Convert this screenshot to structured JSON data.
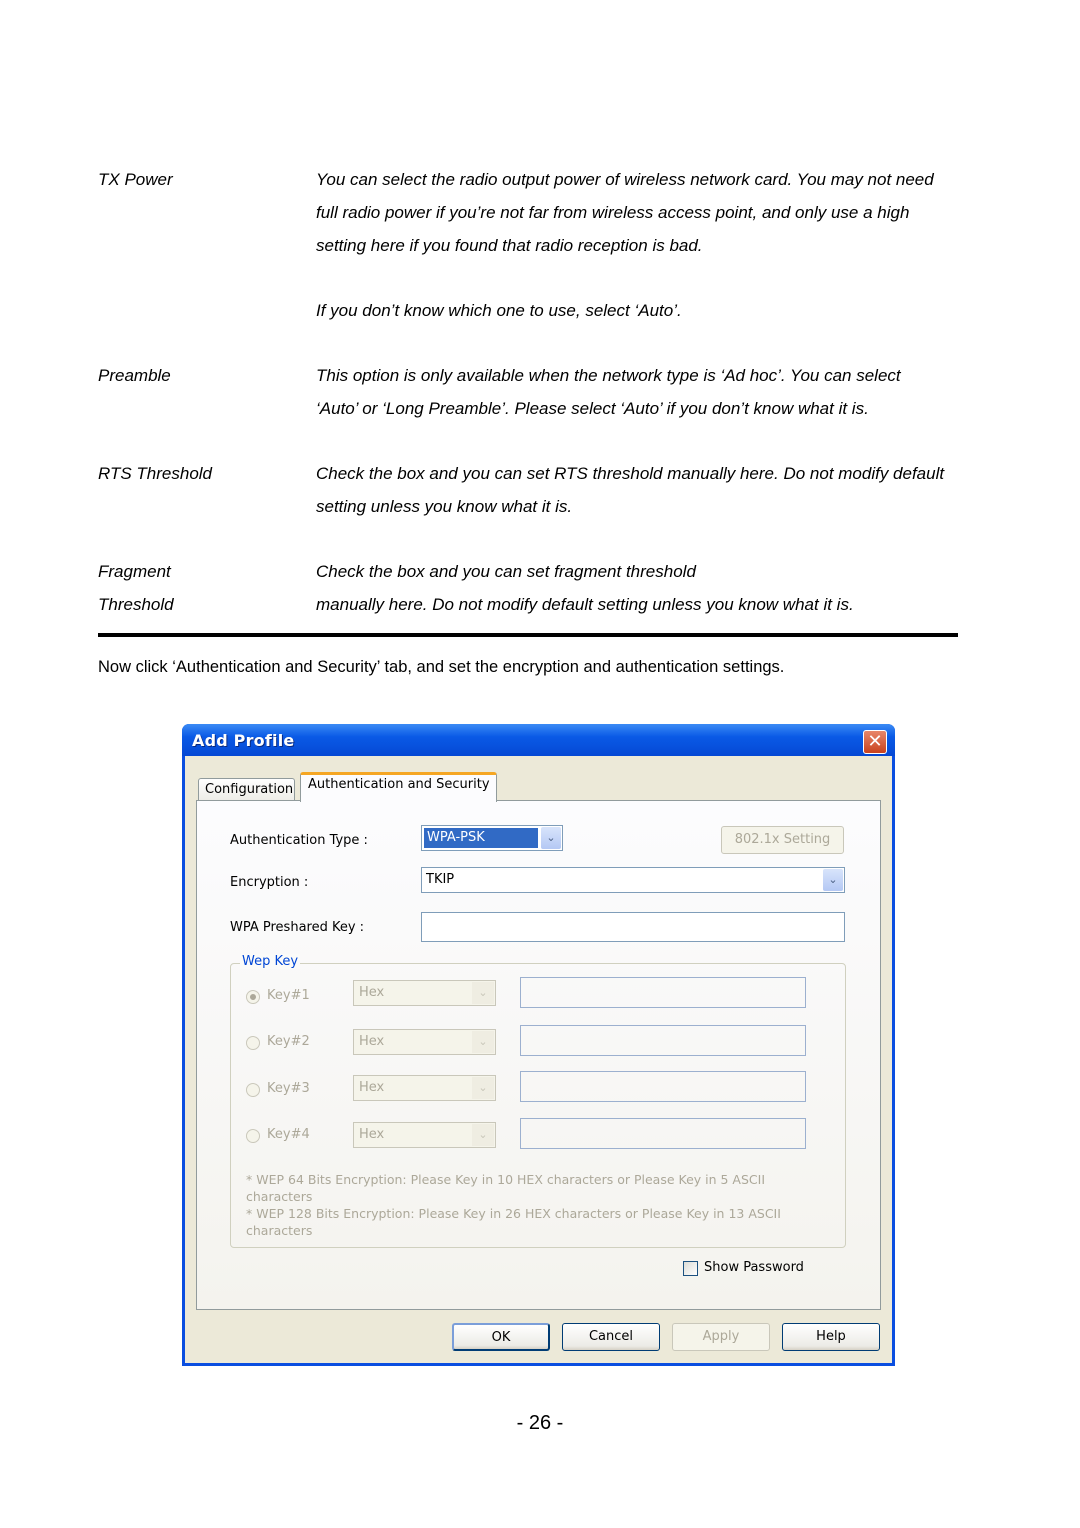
{
  "definitions": [
    {
      "term": "TX Power",
      "desc": [
        "You can select the radio output power of wireless network card. You may not need",
        "full radio power if you’re not far from wireless access point, and only use a high",
        "setting here if you found that radio reception is bad.",
        "",
        "If you don’t know which one to use, select ‘Auto’."
      ]
    },
    {
      "term": "Preamble",
      "desc": [
        "This option is only available when the network type is ‘Ad hoc’. You can select",
        "‘Auto’ or ‘Long Preamble’. Please select ‘Auto’ if you don’t know what it is."
      ]
    },
    {
      "term": "RTS Threshold",
      "desc": [
        "Check the box and you can set RTS threshold manually here. Do not modify default",
        "setting unless you know what it is."
      ]
    },
    {
      "term_lines": [
        "Fragment",
        "Threshold"
      ],
      "desc": [
        "Check the box and you can set fragment threshold",
        "manually here. Do not modify default setting unless you know what it is."
      ]
    }
  ],
  "intro": "Now click ‘Authentication and Security’ tab, and set the encryption and authentication settings.",
  "dialog": {
    "title": "Add Profile",
    "close_glyph": "✕",
    "tabs": [
      {
        "label": "Configuration",
        "active": false
      },
      {
        "label": "Authentication and Security",
        "active": true
      }
    ],
    "auth_type": {
      "label": "Authentication Type :",
      "value": "WPA-PSK"
    },
    "setting_button": "802.1x Setting",
    "encryption": {
      "label": "Encryption :",
      "value": "TKIP"
    },
    "preshared_key": {
      "label": "WPA Preshared Key :",
      "value": ""
    },
    "wep_group": {
      "legend": "Wep Key",
      "keys": [
        {
          "label": "Key#1",
          "format": "Hex",
          "checked": true,
          "value": ""
        },
        {
          "label": "Key#2",
          "format": "Hex",
          "checked": false,
          "value": ""
        },
        {
          "label": "Key#3",
          "format": "Hex",
          "checked": false,
          "value": ""
        },
        {
          "label": "Key#4",
          "format": "Hex",
          "checked": false,
          "value": ""
        }
      ],
      "notes": [
        "* WEP 64 Bits Encryption:   Please Key in 10 HEX characters  or   Please Key in 5 ASCII",
        "characters",
        "* WEP 128 Bits Encryption:   Please Key in 26 HEX characters  or  Please Key in 13 ASCII",
        "characters"
      ]
    },
    "show_password": {
      "label": "Show Password",
      "checked": false
    },
    "buttons": {
      "ok": "OK",
      "cancel": "Cancel",
      "apply": "Apply",
      "help": "Help"
    },
    "arrow_glyph": "⌄"
  },
  "page_number": "- 26 -"
}
